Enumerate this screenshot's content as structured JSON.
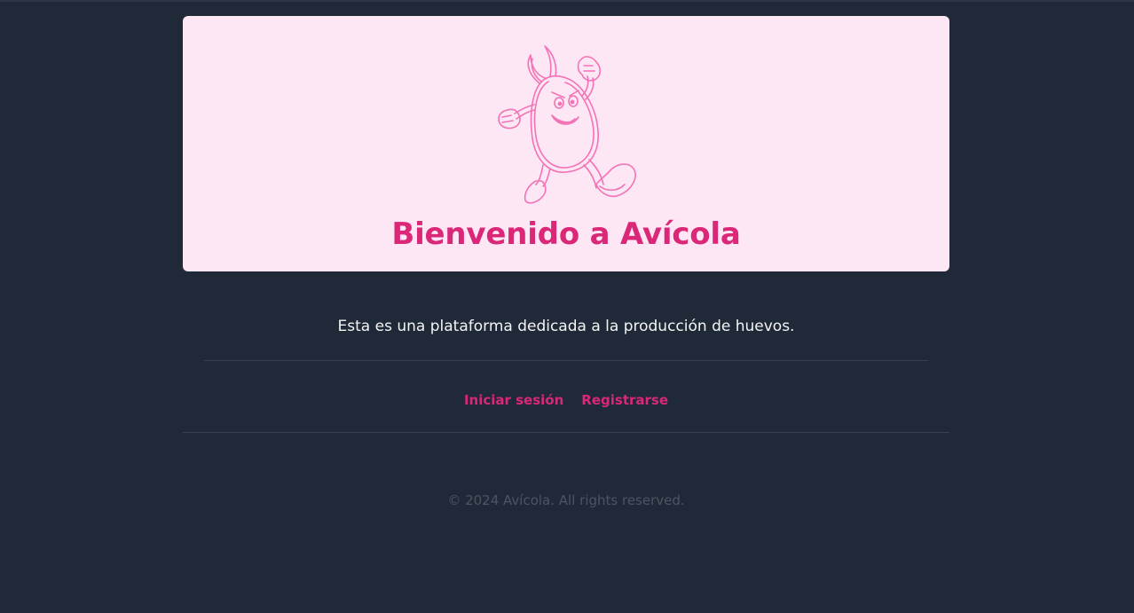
{
  "colors": {
    "page_background": "#1f2937",
    "hero_background": "#fde7f4",
    "accent": "#db2777",
    "mascot_stroke": "#f472b6",
    "body_text": "#f3f4f6",
    "footer_text": "#4b5563",
    "divider": "#374151"
  },
  "hero": {
    "mascot_icon": "running-egg-mascot-icon",
    "title": "Bienvenido a Avícola"
  },
  "main": {
    "description": "Esta es una plataforma dedicada a la producción de huevos."
  },
  "nav": {
    "login_label": "Iniciar sesión",
    "register_label": "Registrarse"
  },
  "footer": {
    "copyright": "© 2024 Avícola. All rights reserved."
  }
}
